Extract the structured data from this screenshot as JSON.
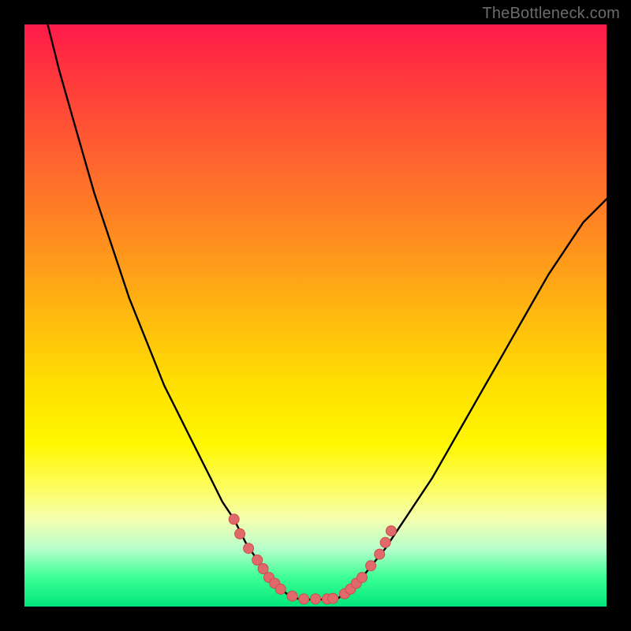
{
  "watermark": "TheBottleneck.com",
  "colors": {
    "page_bg": "#000000",
    "curve": "#000000",
    "dot_fill": "#e06a6a",
    "dot_stroke": "#c94f4f",
    "gradient_top": "#ff1a4a",
    "gradient_bottom": "#00e67a"
  },
  "chart_data": {
    "type": "line",
    "title": "",
    "xlabel": "",
    "ylabel": "",
    "xlim": [
      0,
      100
    ],
    "ylim": [
      0,
      100
    ],
    "grid": false,
    "legend": false,
    "series": [
      {
        "name": "bottleneck-curve-left",
        "x": [
          4,
          6,
          8,
          10,
          12,
          14,
          16,
          18,
          20,
          22,
          24,
          26,
          28,
          30,
          32,
          34,
          36,
          38,
          40,
          42,
          44,
          46
        ],
        "y": [
          100,
          92,
          85,
          78,
          71,
          65,
          59,
          53,
          48,
          43,
          38,
          34,
          30,
          26,
          22,
          18,
          15,
          11,
          8,
          5,
          3,
          1.5
        ]
      },
      {
        "name": "bottleneck-curve-floor",
        "x": [
          46,
          48,
          50,
          52,
          54
        ],
        "y": [
          1.5,
          1.2,
          1.2,
          1.2,
          1.5
        ]
      },
      {
        "name": "bottleneck-curve-right",
        "x": [
          54,
          56,
          58,
          60,
          62,
          64,
          66,
          68,
          70,
          72,
          74,
          76,
          78,
          80,
          82,
          84,
          86,
          88,
          90,
          92,
          94,
          96,
          98,
          100
        ],
        "y": [
          1.5,
          3,
          5,
          7.5,
          10,
          13,
          16,
          19,
          22,
          25.5,
          29,
          32.5,
          36,
          39.5,
          43,
          46.5,
          50,
          53.5,
          57,
          60,
          63,
          66,
          68,
          70
        ]
      }
    ],
    "marker_clusters": [
      {
        "name": "left-band",
        "points": [
          {
            "x": 36,
            "y": 15
          },
          {
            "x": 37,
            "y": 12.5
          },
          {
            "x": 38.5,
            "y": 10
          },
          {
            "x": 40,
            "y": 8
          },
          {
            "x": 41,
            "y": 6.5
          },
          {
            "x": 42,
            "y": 5
          },
          {
            "x": 43,
            "y": 4
          },
          {
            "x": 44,
            "y": 3
          },
          {
            "x": 46,
            "y": 1.8
          }
        ]
      },
      {
        "name": "floor-band",
        "points": [
          {
            "x": 48,
            "y": 1.3
          },
          {
            "x": 50,
            "y": 1.3
          },
          {
            "x": 52,
            "y": 1.3
          },
          {
            "x": 53,
            "y": 1.4
          }
        ]
      },
      {
        "name": "right-band",
        "points": [
          {
            "x": 55,
            "y": 2.2
          },
          {
            "x": 56,
            "y": 3
          },
          {
            "x": 57,
            "y": 4
          },
          {
            "x": 58,
            "y": 5
          },
          {
            "x": 59.5,
            "y": 7
          },
          {
            "x": 61,
            "y": 9
          },
          {
            "x": 62,
            "y": 11
          },
          {
            "x": 63,
            "y": 13
          }
        ]
      }
    ]
  }
}
